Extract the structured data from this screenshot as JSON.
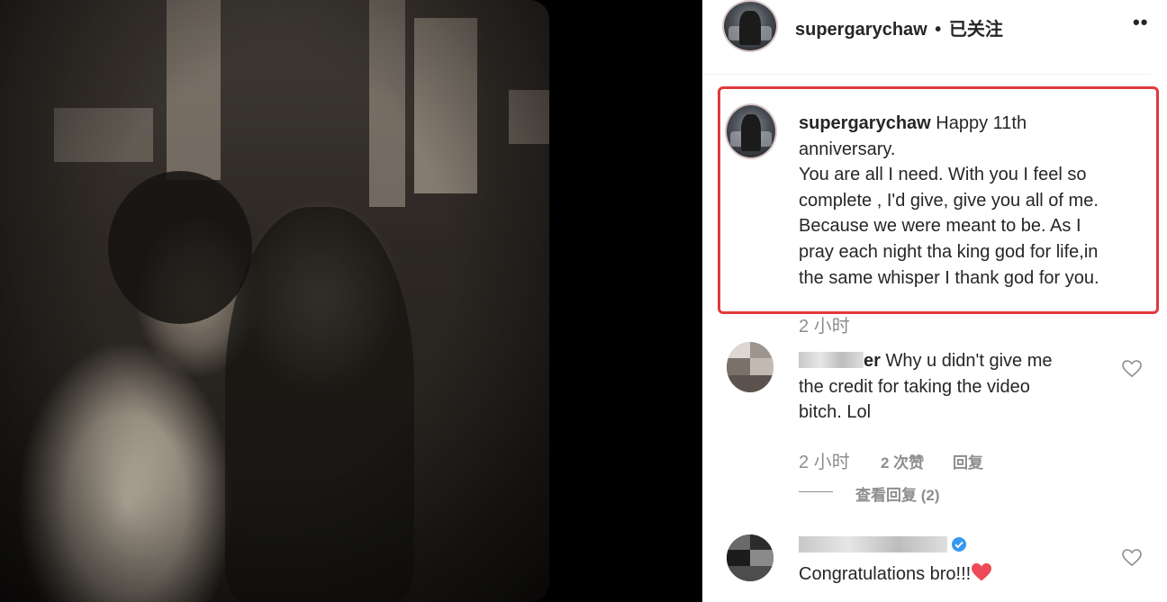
{
  "header": {
    "username": "supergarychaw",
    "separator": "•",
    "follow_status": "已关注",
    "more_icon": "••"
  },
  "caption": {
    "username": "supergarychaw",
    "text_first": "Happy 11th",
    "lines": [
      "anniversary.",
      "You are all I need. With you I feel so",
      "complete , I'd give, give you all of me.",
      "Because we were meant to be. As I",
      "pray each night tha king god for life,in",
      "the same whisper I thank god for you."
    ],
    "time": "2 小时"
  },
  "comments": [
    {
      "name_tail": "er",
      "lines": [
        "Why u didn't give me",
        "the credit for taking the video",
        "bitch. Lol"
      ],
      "time": "2 小时",
      "likes": "2 次赞",
      "reply": "回复",
      "view_replies": "查看回复 (2)"
    },
    {
      "verified_icon": "verified-badge-icon",
      "text": "Congratulations bro!!!",
      "emoji": "❤️"
    }
  ],
  "colors": {
    "highlight_border": "#e0393e",
    "verified": "#3897f0",
    "heart_emoji": "#ed4956"
  }
}
